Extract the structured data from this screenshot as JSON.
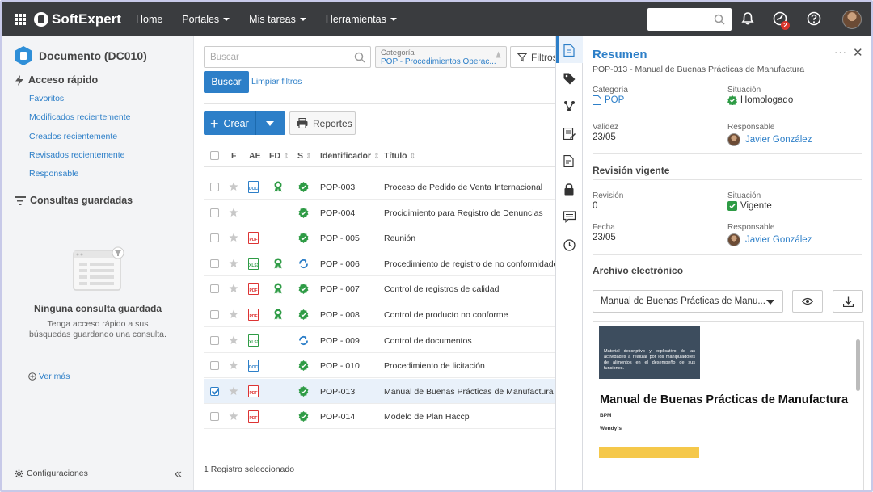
{
  "topbar": {
    "brand": "SoftExpert",
    "nav": [
      "Home",
      "Portales",
      "Mis tareas",
      "Herramientas"
    ],
    "notification_badge": "2"
  },
  "sidebar": {
    "doc_title": "Documento (DC010)",
    "quick_access_title": "Acceso rápido",
    "quick_links": [
      "Favoritos",
      "Modificados recientemente",
      "Creados recientemente",
      "Revisados recientemente",
      "Responsable"
    ],
    "saved_queries_title": "Consultas guardadas",
    "empty_title": "Ninguna consulta guardada",
    "empty_desc": "Tenga acceso rápido a sus búsquedas guardando una consulta.",
    "ver_mas": "Ver más",
    "config": "Configuraciones"
  },
  "main": {
    "search_placeholder": "Buscar",
    "category_label": "Categoría",
    "category_value": "POP - Procedimientos Operac...",
    "filtros": "Filtros",
    "buscar": "Buscar",
    "limpiar": "Limpiar filtros",
    "crear": "Crear",
    "reportes": "Reportes",
    "columns": [
      "F",
      "AE",
      "FD",
      "S",
      "Identificador",
      "Título"
    ],
    "rows": [
      {
        "id": "POP-003",
        "title": "Proceso de Pedido de Venta Internacional",
        "file": "doc",
        "fd": true,
        "status": "ok",
        "checked": false
      },
      {
        "id": "POP-004",
        "title": "Procidimiento para Registro de Denuncias",
        "file": "",
        "fd": false,
        "status": "ok",
        "checked": false
      },
      {
        "id": "POP - 005",
        "title": "Reunión",
        "file": "pdf",
        "fd": false,
        "status": "ok",
        "checked": false
      },
      {
        "id": "POP - 006",
        "title": "Procedimiento de registro de no conformidades",
        "file": "xlsx",
        "fd": true,
        "status": "cycle",
        "checked": false
      },
      {
        "id": "POP - 007",
        "title": "Control de registros de calidad",
        "file": "pdf",
        "fd": true,
        "status": "ok",
        "checked": false
      },
      {
        "id": "POP - 008",
        "title": "Control de producto no conforme",
        "file": "pdf",
        "fd": true,
        "status": "ok",
        "checked": false
      },
      {
        "id": "POP - 009",
        "title": "Control de documentos",
        "file": "xlsx",
        "fd": false,
        "status": "cycle",
        "checked": false
      },
      {
        "id": "POP - 010",
        "title": "Procedimiento de licitación",
        "file": "doc",
        "fd": false,
        "status": "ok",
        "checked": false
      },
      {
        "id": "POP-013",
        "title": "Manual de Buenas Prácticas de Manufactura",
        "file": "pdf",
        "fd": false,
        "status": "ok",
        "checked": true
      },
      {
        "id": "POP-014",
        "title": "Modelo de Plan Haccp",
        "file": "pdf",
        "fd": false,
        "status": "ok",
        "checked": false
      }
    ],
    "selected_count": "1 Registro seleccionado"
  },
  "panel": {
    "title": "Resumen",
    "subtitle": "POP-013 - Manual de Buenas Prácticas de Manufactura",
    "categoria_label": "Categoría",
    "categoria_value": "POP",
    "situacion_label": "Situación",
    "situacion_value": "Homologado",
    "validez_label": "Validez",
    "validez_value": "23/05",
    "responsable_label": "Responsable",
    "responsable_value": "Javier González",
    "revision_title": "Revisión vigente",
    "revision_label": "Revisión",
    "revision_value": "0",
    "rev_situacion_label": "Situación",
    "rev_situacion_value": "Vigente",
    "fecha_label": "Fecha",
    "fecha_value": "23/05",
    "rev_responsable_label": "Responsable",
    "rev_responsable_value": "Javier González",
    "archivo_title": "Archivo electrónico",
    "file_select_value": "Manual de Buenas Prácticas de Manu...",
    "preview": {
      "box_text": "Material descriptivo y explicativo de las actividades a realizar por los manipuladores de alimentos en el desempeño de sus funciones.",
      "title": "Manual de Buenas Prácticas de Manufactura",
      "line1": "BPM",
      "line2": "Wendy´s"
    }
  },
  "colors": {
    "topbar": "#3a3c3f",
    "accent": "#2d7fc8",
    "ok_green": "#2e9b45"
  }
}
